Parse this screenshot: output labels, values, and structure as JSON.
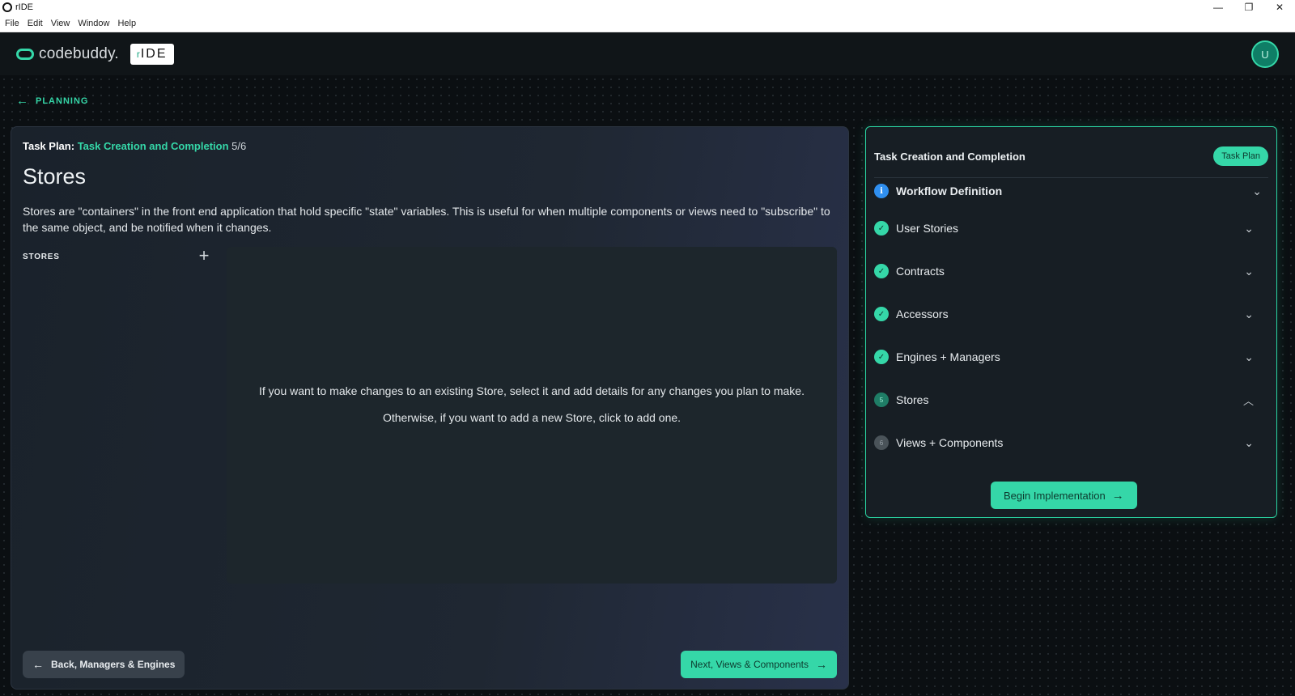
{
  "window": {
    "title": "rIDE",
    "controls": {
      "minimize": "—",
      "restore": "❐",
      "close": "✕"
    }
  },
  "menu": [
    "File",
    "Edit",
    "View",
    "Window",
    "Help"
  ],
  "header": {
    "brand": "codebuddy.",
    "badge_prefix": "r",
    "badge_text": "IDE",
    "avatar_initial": "U"
  },
  "nav": {
    "back_label": "PLANNING"
  },
  "main": {
    "taskplan_label": "Task Plan:",
    "taskplan_name": "Task Creation and Completion",
    "taskplan_progress": "5/6",
    "title": "Stores",
    "description": "Stores are \"containers\" in the front end application that hold specific \"state\" variables. This is useful for when multiple components or views need to \"subscribe\" to the same object, and be notified when it changes.",
    "stores_header": "STORES",
    "add_symbol": "+",
    "empty_line1": "If you want to make changes to an existing Store, select it and add details for any changes you plan to make.",
    "empty_line2": "Otherwise, if you want to add a new Store, click to add one.",
    "back_button": "Back, Managers & Engines",
    "next_button": "Next, Views & Components"
  },
  "plan_card": {
    "title": "Task Creation and Completion",
    "badge": "Task Plan",
    "steps": [
      {
        "label": "Workflow Definition",
        "status": "info",
        "icon": "i"
      },
      {
        "label": "User Stories",
        "status": "done",
        "icon": "✓"
      },
      {
        "label": "Contracts",
        "status": "done",
        "icon": "✓"
      },
      {
        "label": "Accessors",
        "status": "done",
        "icon": "✓"
      },
      {
        "label": "Engines + Managers",
        "status": "done",
        "icon": "✓"
      },
      {
        "label": "Stores",
        "status": "current",
        "icon": "5"
      },
      {
        "label": "Views + Components",
        "status": "pending",
        "icon": "6"
      }
    ],
    "begin_button": "Begin Implementation"
  },
  "colors": {
    "accent": "#35d7a8",
    "info": "#2f8ff0",
    "panel": "#1f2732"
  }
}
